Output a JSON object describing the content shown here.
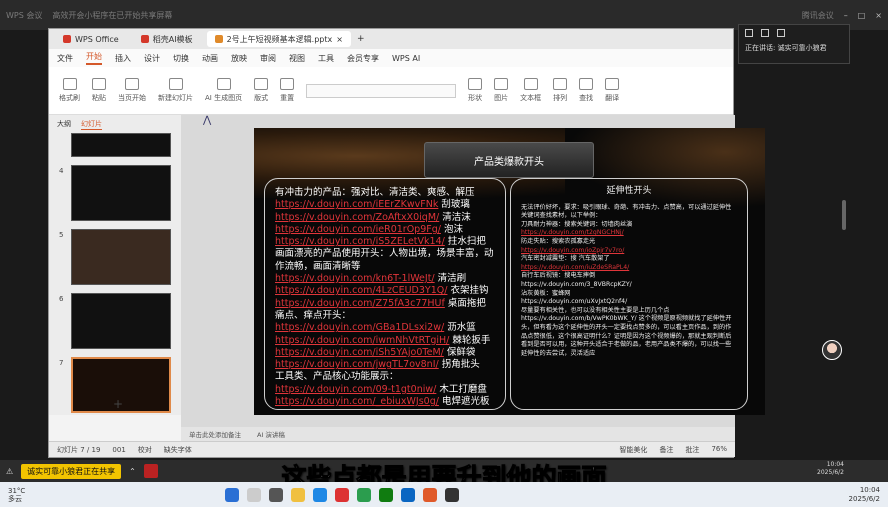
{
  "outer_top": {
    "left_text": "WPS 会议",
    "mid_text": "高效开会小程序在已开始共享屏幕",
    "right_text": "腾讯会议"
  },
  "wps": {
    "tabs": [
      {
        "label": "WPS Office",
        "color": "#d4382a"
      },
      {
        "label": "稻壳AI模板",
        "color": "#d4382a"
      },
      {
        "label": "2号上午短视频基本逻辑.pptx",
        "color": "#e08a2a"
      }
    ],
    "menu": [
      "文件",
      "开始",
      "插入",
      "设计",
      "切换",
      "动画",
      "放映",
      "审阅",
      "视图",
      "工具",
      "会员专享",
      "WPS AI"
    ],
    "active_menu": "开始",
    "ribbon": [
      "格式刷",
      "粘贴",
      "当页开始",
      "新建幻灯片",
      "AI 生成图页",
      "版式",
      "重置",
      "形状",
      "图片",
      "文本框",
      "排列",
      "查找",
      "选择",
      "翻译"
    ],
    "left_tabs": [
      "大纲",
      "幻灯片"
    ],
    "slide_numbers": [
      "4",
      "5",
      "6",
      "7"
    ],
    "notes_placeholder": "单击此处添加备注",
    "ai_note": "AI 演讲稿",
    "status": {
      "slide_counter": "幻灯片 7 / 19",
      "theme": "001",
      "proofing": "校对",
      "missing_font": "缺失字体",
      "smart_beautify": "智能美化",
      "notes": "备注",
      "comment": "批注",
      "zoom": "76%"
    }
  },
  "slide": {
    "title": "产品类爆款开头",
    "left": {
      "intro": "有冲击力的产品：强对比、清洁类、爽感、解压",
      "rows1": [
        {
          "link": "https://v.douyin.com/iEErZKwvFNk",
          "tag": "刮玻璃"
        },
        {
          "link": "https://v.douyin.com/ZoAftxX0iqM/",
          "tag": "清洁沫"
        },
        {
          "link": "https://v.douyin.com/ieR01rOp9Fg/",
          "tag": "泡沫"
        },
        {
          "link": "https://v.douyin.com/iS5ZELetVk14/",
          "tag": "拄水扫把"
        }
      ],
      "mid1": "画面漂亮的产品使用开头：人物出境，场景丰富，动作流畅，画面清晰等",
      "rows2": [
        {
          "link": "https://v.douyin.com/kn6T-1lWeJt/",
          "tag": "清洁刷"
        },
        {
          "link": "https://v.douyin.com/4LzCEUD3Y1Q/",
          "tag": "衣架挂钩"
        },
        {
          "link": "https://v.douyin.com/Z75fA3c77HUf",
          "tag": "桌面拖把"
        }
      ],
      "mid2": "痛点、痒点开头：",
      "rows3": [
        {
          "link": "https://v.douyin.com/GBa1DLsxi2w/",
          "tag": "沥水篮"
        },
        {
          "link": "https://v.douyin.com/iwmNhVtRTgiH/",
          "tag": "棘轮扳手"
        },
        {
          "link": "https://v.douyin.com/iSh5YAjo0TeM/",
          "tag": "保鲜袋"
        },
        {
          "link": "https://v.douyin.com/jwgTL7ov8nI/",
          "tag": "拐角批头"
        }
      ],
      "mid3": "工具类、产品核心功能展示：",
      "rows4": [
        {
          "link": "https://v.douyin.com/09-t1gt0niw/",
          "tag": "木工打磨盘"
        },
        {
          "link": "https://v.douyin.com/_ebiuxWJs0g/",
          "tag": "电焊遮光板"
        }
      ]
    },
    "right": {
      "title": "延伸性开头",
      "intro": "无法评价好坏，要求：吸引眼球、奇葩、有冲击力、点赞高，可以通过延伸性关键词查找素材，以下举例：",
      "item1": "刀具耐力神器：搜索关键词：切墙肉丝演",
      "item1_link": "https://v.douyin.com/t2gNGCHNj/",
      "item2": "防走失贴：搜索农孤寡走光",
      "item2_link": "https://v.douyin.com/ioZpjr7v7ro/",
      "item3": "汽车密封减震垫：搜 汽车散架了",
      "item3_link": "https://v.douyin.com/iuZdeSRaPL4/",
      "item4": "自行车后视镜：搜电车摔倒",
      "item4_link": "https://v.douyin.com/3_8VBRcpKZY/",
      "item5": "沾灰黄板：蜜蜂网",
      "item5_link": "https://v.douyin.com/uXvJxtQ2nf4/",
      "outro": "尽量要有相关性，也可以没有相关性主要是上历几个点 https://v.douyin.com/b/VwPK0bWK_Y/ 这个视频是原视频就找了延伸性开头，但有看为这个延伸性的开头一定要找点赞多的，可以看主页作品，到的作品点赞很低，这个很高证明什么？证明是因为这个视频爆的，那就主观判断后看到是否可以用，这种开头适合于老做的品，老用产品类不爆的，可以找一些延伸性的去尝试，灵活适应"
    }
  },
  "share_panel": {
    "label": "正在讲话:",
    "name": "诚实可靠小狼君"
  },
  "share_bar": {
    "badge": "诚实可靠小狼君正在共享"
  },
  "subtitle": "这些点都是用要升到他的画面",
  "inner_clock": {
    "time": "10:04",
    "date": "2025/6/2"
  },
  "taskbar": {
    "temperature": "31°C",
    "weather": "多云",
    "time": "10:04",
    "date": "2025/6/2"
  }
}
